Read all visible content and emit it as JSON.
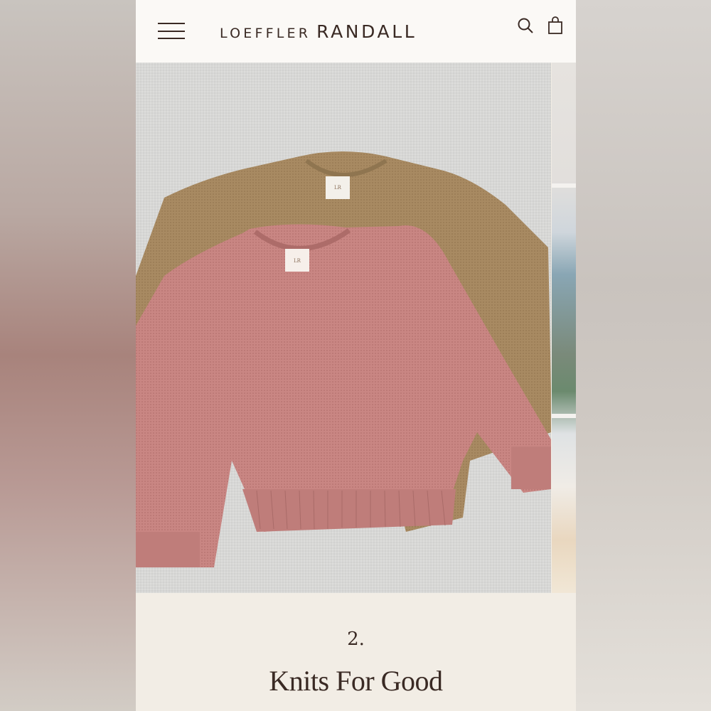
{
  "header": {
    "brand_first": "LOEFFLER",
    "brand_second": "RANDALL",
    "menu_icon": "hamburger-menu-icon",
    "search_icon": "search-icon",
    "bag_icon": "shopping-bag-icon"
  },
  "carousel": {
    "main_image": "pink and brown knit puff-sleeve sweaters on a rug",
    "peek_image": "interior room with window"
  },
  "caption": {
    "number": "2.",
    "title": "Knits For Good"
  },
  "colors": {
    "text": "#3a2a24",
    "header_bg": "#fbf9f6",
    "caption_bg": "#f2ede5",
    "pink_sweater": "#c98683",
    "brown_sweater": "#a88a62"
  }
}
